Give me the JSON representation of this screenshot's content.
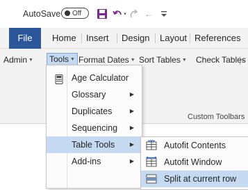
{
  "titlebar": {
    "autosave_label": "AutoSave",
    "autosave_toggle": "Off",
    "icons": [
      "save-icon",
      "undo-icon",
      "redo-icon",
      "back-arrow-icon",
      "customize-quick-access-icon"
    ]
  },
  "ribbon_tabs": [
    "File",
    "Home",
    "Insert",
    "Design",
    "Layout",
    "References"
  ],
  "toolbar": {
    "admin": "Admin",
    "tools": "Tools",
    "format_dates": "Format Dates",
    "sort_tables": "Sort Tables",
    "check_tables": "Check Tables",
    "group_label": "Custom Toolbars"
  },
  "tools_menu": {
    "items": [
      {
        "label": "Age Calculator",
        "icon": "calculator-icon",
        "submenu": false
      },
      {
        "label": "Glossary",
        "submenu": true
      },
      {
        "label": "Duplicates",
        "submenu": true
      },
      {
        "label": "Sequencing",
        "submenu": true
      },
      {
        "label": "Table Tools",
        "submenu": true,
        "highlighted": true
      },
      {
        "label": "Add-ins",
        "submenu": true
      }
    ]
  },
  "table_tools_menu": {
    "items": [
      {
        "label": "Autofit Contents",
        "icon": "autofit-contents-icon"
      },
      {
        "label": "Autofit Window",
        "icon": "autofit-window-icon"
      },
      {
        "label": "Split at current row",
        "icon": "split-table-icon",
        "highlighted": true
      }
    ]
  },
  "colors": {
    "file_tab": "#2b579a",
    "menu_highlight": "#c5d9f1",
    "ribbon_bg": "#f3f3f3",
    "save_icon": "#7b2a8e"
  }
}
